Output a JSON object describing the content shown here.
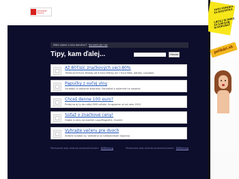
{
  "logo": {
    "line1": "ADVANCE",
    "line2": "TOOLS"
  },
  "topbar": {
    "text": "Máte zájem o tuto doménu?",
    "link_text": "Kontaktujte nás"
  },
  "main": {
    "heading": "Tipy, kam ďalej...",
    "search": {
      "placeholder": "",
      "button_label": "Hledat"
    },
    "items": [
      {
        "title": "Až 80Tisíc značkových vecí-80%",
        "description": "Tričká od 6 Euro Tenisky od 8 Euro Mikiny od 7 Euro Nike, Adidas, Lonsdale"
      },
      {
        "title": "Papučky z ovčej vlny",
        "description": "Vyrábajú si teplotné elástlosti. Pohodlné a prijemné na nosenie."
      },
      {
        "title": "Chceš denne 100 euro?",
        "description": "Pridaj sa aj ty do našej SMS súťaže, fungujeme už od roku 2015"
      },
      {
        "title": "Súťaž o značkové ceny!",
        "description": "Hrajte o ceny od značiek Lasa/Magnetic, Dunhill."
      },
      {
        "title": "Vyhrajte večeru pre dvoch",
        "description": "Strávte sviatok sv. Valentína so svätostníkom Soprano"
      }
    ]
  },
  "footer": {
    "left_text": "Parkovaná web stránka prostredníctvom",
    "left_link": "DNParking",
    "right_text": "Parkovaná web stránka prostredníctvom",
    "right_link": "DNParking"
  },
  "ad": {
    "line1": "TATO PONUKA",
    "line2": "ZA DOSTATKA",
    "line3": "LIETAJ SI DNES",
    "line4": "ZA 9,99 EUR",
    "line5": "SI DOPĽŇAŤ",
    "brand": "pelikán.sk"
  }
}
